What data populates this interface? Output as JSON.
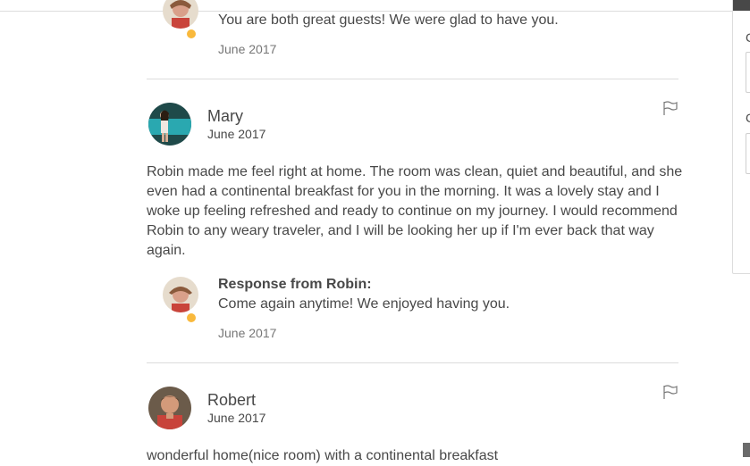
{
  "reviews_prev": {
    "response_text": "You are both great guests! We were glad to have you.",
    "response_date": "June 2017"
  },
  "reviews": [
    {
      "name": "Mary",
      "date": "June 2017",
      "text": "Robin made me feel right at home. The room was clean, quiet and beautiful, and she even had a continental breakfast for you in the morning. It was a lovely stay and I woke up feeling refreshed and ready to continue on my journey. I would recommend Robin to any weary traveler, and I will be looking her up if I'm ever back that way again.",
      "response_title": "Response from Robin:",
      "response_text": "Come again anytime! We enjoyed having you.",
      "response_date": "June 2017"
    },
    {
      "name": "Robert",
      "date": "June 2017",
      "text": "wonderful home(nice room) with a continental breakfast"
    }
  ],
  "colors": {
    "text": "#484848",
    "muted": "#767676",
    "divider": "#dcdcdc",
    "host_badge": "#f9b93c"
  },
  "icons": {
    "flag": "flag-icon",
    "host_badge": "host-badge-icon"
  }
}
